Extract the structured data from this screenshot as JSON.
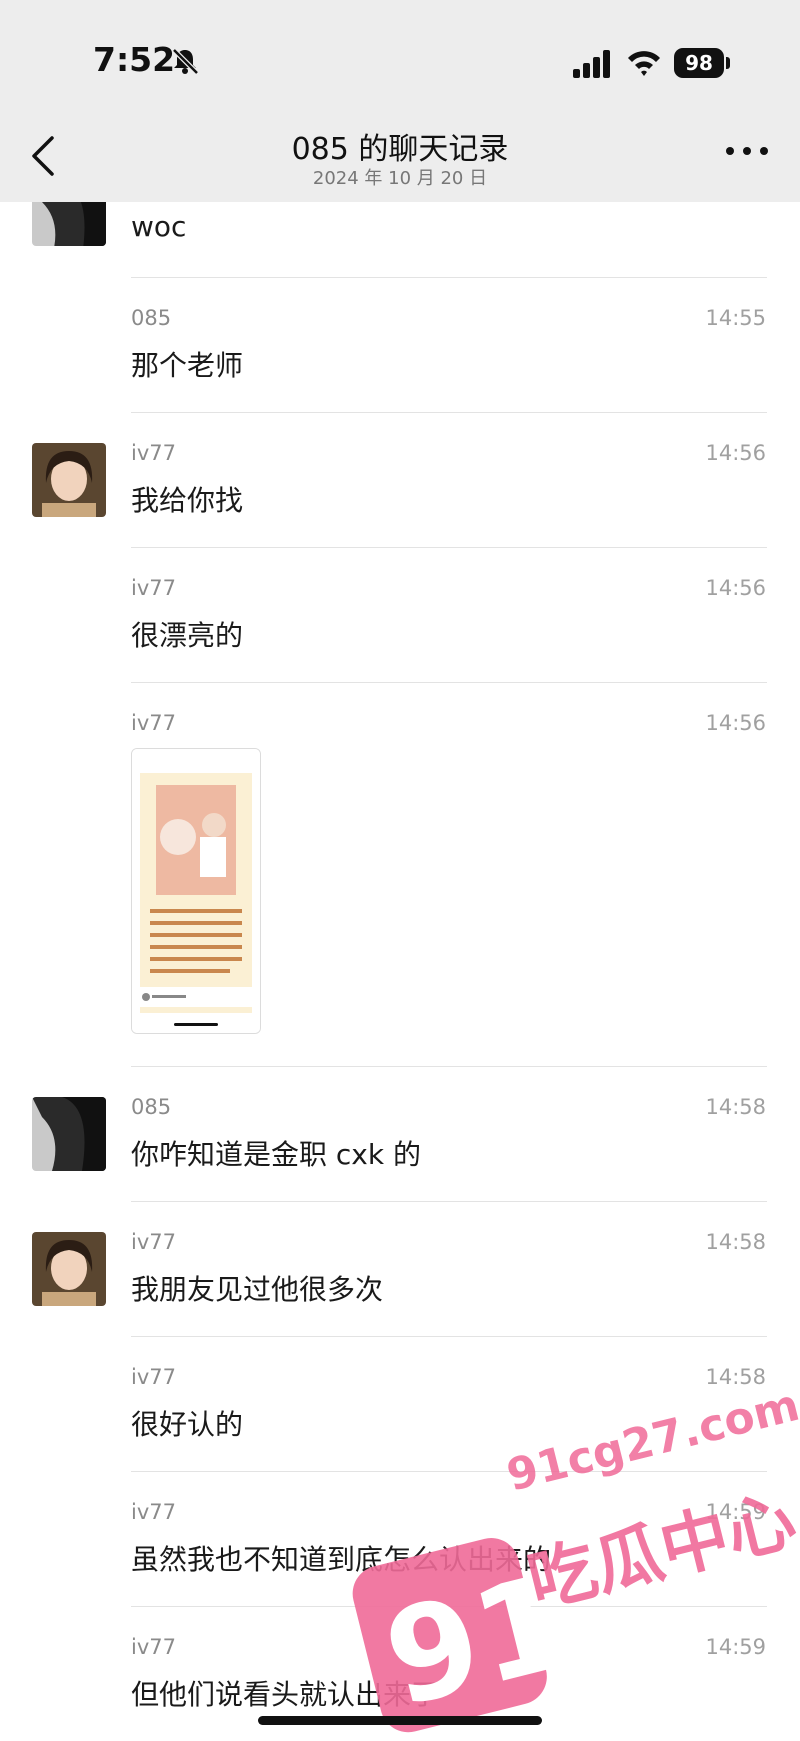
{
  "status_bar": {
    "time": "7:52",
    "battery": "98"
  },
  "nav": {
    "title": "085 的聊天记录",
    "subtitle": "2024 年 10 月 20 日"
  },
  "messages": [
    {
      "sender": "",
      "time": "",
      "text": "woc",
      "avatar": "085"
    },
    {
      "sender": "085",
      "time": "14:55",
      "text": "那个老师",
      "avatar": ""
    },
    {
      "sender": "iv77",
      "time": "14:56",
      "text": "我给你找",
      "avatar": "iv77"
    },
    {
      "sender": "iv77",
      "time": "14:56",
      "text": "很漂亮的",
      "avatar": ""
    },
    {
      "sender": "iv77",
      "time": "14:56",
      "text": "",
      "avatar": ""
    },
    {
      "sender": "085",
      "time": "14:58",
      "text": "你咋知道是金职 cxk 的",
      "avatar": "085"
    },
    {
      "sender": "iv77",
      "time": "14:58",
      "text": "我朋友见过他很多次",
      "avatar": "iv77"
    },
    {
      "sender": "iv77",
      "time": "14:58",
      "text": "很好认的",
      "avatar": ""
    },
    {
      "sender": "iv77",
      "time": "14:59",
      "text": "虽然我也不知道到底怎么认出来的",
      "avatar": ""
    },
    {
      "sender": "iv77",
      "time": "14:59",
      "text": "但他们说看头就认出来了",
      "avatar": ""
    }
  ],
  "watermark": {
    "site": "91cg27.com",
    "big": "91",
    "brand": "吃瓜中心"
  },
  "colors": {
    "nav_bg": "#ededed",
    "watermark": "#f06a98",
    "separator": "#e3e3e3"
  }
}
